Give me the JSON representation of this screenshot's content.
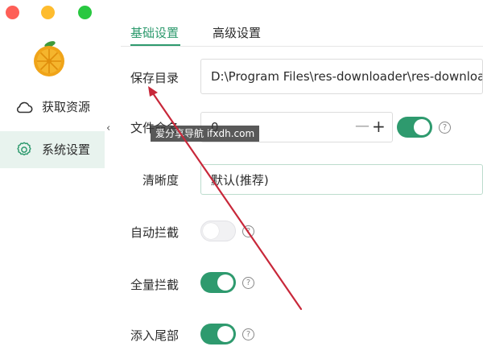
{
  "sidebar": {
    "items": [
      {
        "label": "获取资源",
        "icon": "cloud-icon"
      },
      {
        "label": "系统设置",
        "icon": "gear-icon",
        "active": true
      }
    ],
    "collapse_glyph": "‹"
  },
  "tabs": [
    {
      "label": "基础设置",
      "active": true
    },
    {
      "label": "高级设置",
      "active": false
    }
  ],
  "form": {
    "save_dir": {
      "label": "保存目录",
      "value": "D:\\Program Files\\res-downloader\\res-downloader"
    },
    "file_count": {
      "label": "文件命名",
      "value": "0",
      "minus": "—",
      "plus": "+",
      "toggle_on": true
    },
    "quality": {
      "label": "清晰度",
      "value": "默认(推荐)"
    },
    "auto_intercept": {
      "label": "自动拦截",
      "toggle_on": false
    },
    "full_intercept": {
      "label": "全量拦截",
      "toggle_on": true
    },
    "append_tail": {
      "label": "添入尾部",
      "toggle_on": true
    }
  },
  "watermark": {
    "text": "爱分享导航  ifxdh.com"
  },
  "colors": {
    "accent": "#2e9a6e",
    "annotation_arrow": "#c8283a"
  }
}
